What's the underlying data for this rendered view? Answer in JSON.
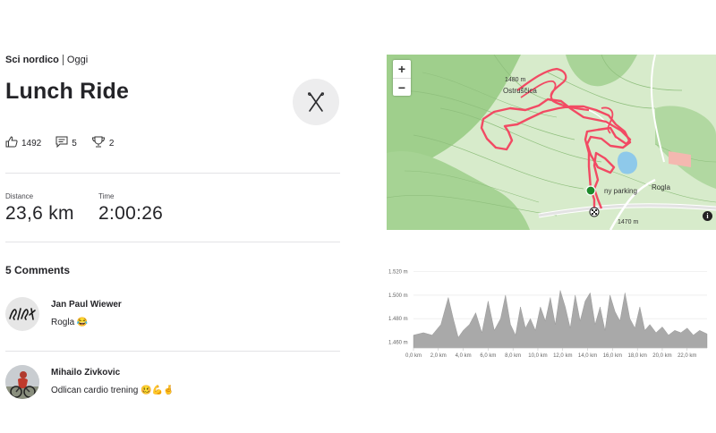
{
  "activity": {
    "sport": "Sci nordico",
    "date": "Oggi",
    "title": "Lunch Ride",
    "sport_icon": "nordic-ski-icon"
  },
  "social": {
    "kudos": "1492",
    "comments": "5",
    "achievements": "2"
  },
  "metrics": {
    "distance_label": "Distance",
    "distance_value": "23,6 km",
    "time_label": "Time",
    "time_value": "2:00:26"
  },
  "comments_section": {
    "title": "5 Comments",
    "items": [
      {
        "name": "Jan Paul Wiewer",
        "text": "Rogla 😂"
      },
      {
        "name": "Mihailo Zivkovic",
        "text": "Odlican cardio trening 🥴💪🤞"
      }
    ]
  },
  "map": {
    "zoom_in": "+",
    "zoom_out": "−",
    "labels": {
      "elev_1": "1480 m",
      "place": "Ostruščica",
      "parking": "ny parking",
      "town": "Rogla",
      "elev_2": "1470 m",
      "info": "i"
    },
    "route_color": "#f24a63"
  },
  "chart_data": {
    "type": "area",
    "ylabel_ticks": [
      "1.520 m",
      "1.500 m",
      "1.480 m",
      "1.460 m"
    ],
    "y_ticks": [
      1520,
      1500,
      1480,
      1460
    ],
    "ylim": [
      1455,
      1522
    ],
    "xlim": [
      0,
      23.6
    ],
    "x_ticks": [
      0,
      2,
      4,
      6,
      8,
      10,
      12,
      14,
      16,
      18,
      20,
      22
    ],
    "x_tick_labels": [
      "0,0 km",
      "2,0 km",
      "4,0 km",
      "6,0 km",
      "8,0 km",
      "10,0 km",
      "12,0 km",
      "14,0 km",
      "16,0 km",
      "18,0 km",
      "20,0 km",
      "22,0 km"
    ],
    "x": [
      0,
      0.8,
      1.5,
      2.2,
      2.8,
      3.2,
      3.6,
      4.0,
      4.5,
      5.0,
      5.5,
      6.0,
      6.5,
      7.0,
      7.4,
      7.8,
      8.2,
      8.6,
      9.0,
      9.4,
      9.8,
      10.2,
      10.6,
      11.0,
      11.4,
      11.8,
      12.2,
      12.6,
      13.0,
      13.4,
      13.8,
      14.2,
      14.6,
      15.0,
      15.4,
      15.8,
      16.2,
      16.6,
      17.0,
      17.4,
      17.8,
      18.2,
      18.6,
      19.0,
      19.5,
      20.0,
      20.5,
      21.0,
      21.5,
      22.0,
      22.5,
      23.0,
      23.6
    ],
    "y": [
      1466,
      1468,
      1466,
      1475,
      1498,
      1480,
      1464,
      1470,
      1475,
      1485,
      1468,
      1495,
      1470,
      1480,
      1500,
      1475,
      1466,
      1490,
      1472,
      1480,
      1470,
      1490,
      1478,
      1498,
      1475,
      1504,
      1490,
      1472,
      1500,
      1478,
      1495,
      1502,
      1475,
      1490,
      1470,
      1500,
      1486,
      1478,
      1502,
      1480,
      1472,
      1490,
      1470,
      1475,
      1468,
      1473,
      1466,
      1470,
      1468,
      1472,
      1466,
      1470,
      1467
    ],
    "fill": "#a9a9a9",
    "grid": true
  }
}
